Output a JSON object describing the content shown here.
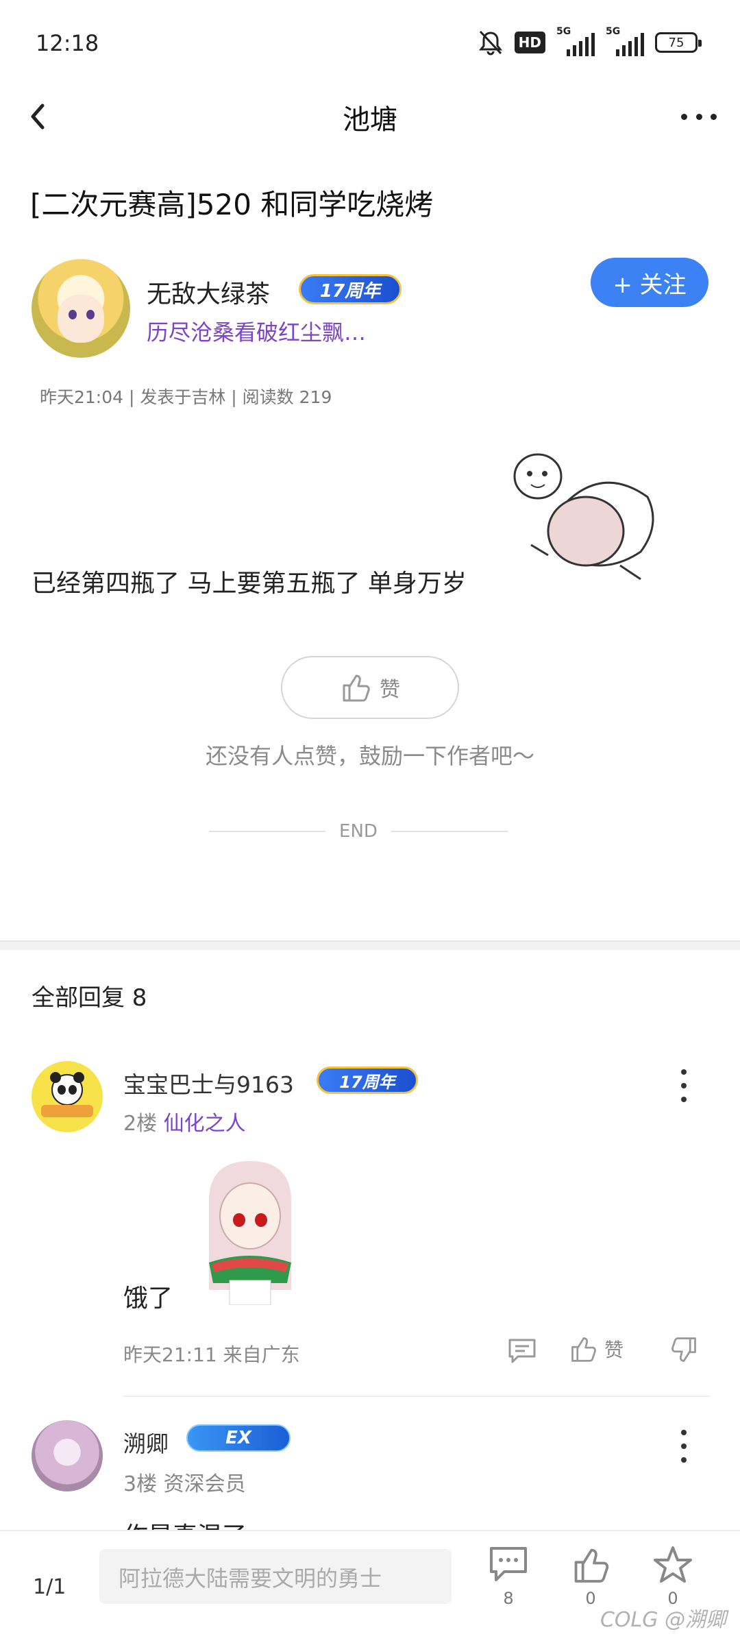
{
  "status_bar": {
    "time": "12:18",
    "hd": "HD",
    "net1": "5G",
    "net2": "5G",
    "battery": "75"
  },
  "nav": {
    "title": "池塘",
    "back_icon": "chevron-left-icon",
    "more_icon": "more-horizontal-icon"
  },
  "post": {
    "title": "[二次元赛高]520 和同学吃烧烤",
    "author": {
      "name": "无敌大绿茶",
      "badge": "17周年",
      "title": "历尽沧桑看破红尘飘…"
    },
    "follow_label": "+ 关注",
    "meta": "昨天21:04 | 发表于吉林 | 阅读数 219",
    "body": "已经第四瓶了 马上要第五瓶了 单身万岁",
    "like_label": "赞",
    "like_hint": "还没有人点赞，鼓励一下作者吧～",
    "end_label": "END"
  },
  "replies": {
    "header": "全部回复  8",
    "items": [
      {
        "name": "宝宝巴士与9163",
        "badge": "17周年",
        "floor": "2楼",
        "level": "仙化之人",
        "text": "饿了",
        "meta": "昨天21:11  来自广东",
        "like_label": "赞"
      },
      {
        "name": "溯卿",
        "badge": "EX",
        "floor": "3楼",
        "level": "资深会员",
        "text": "作是真混了"
      }
    ]
  },
  "bottom_bar": {
    "page": "1/1",
    "placeholder": "阿拉德大陆需要文明的勇士",
    "comments_count": "8",
    "likes_count": "0",
    "favorites_count": "0",
    "watermark": "COLG @溯卿"
  },
  "colors": {
    "accent_blue": "#3d82f5",
    "purple_title": "#7a45c8"
  }
}
